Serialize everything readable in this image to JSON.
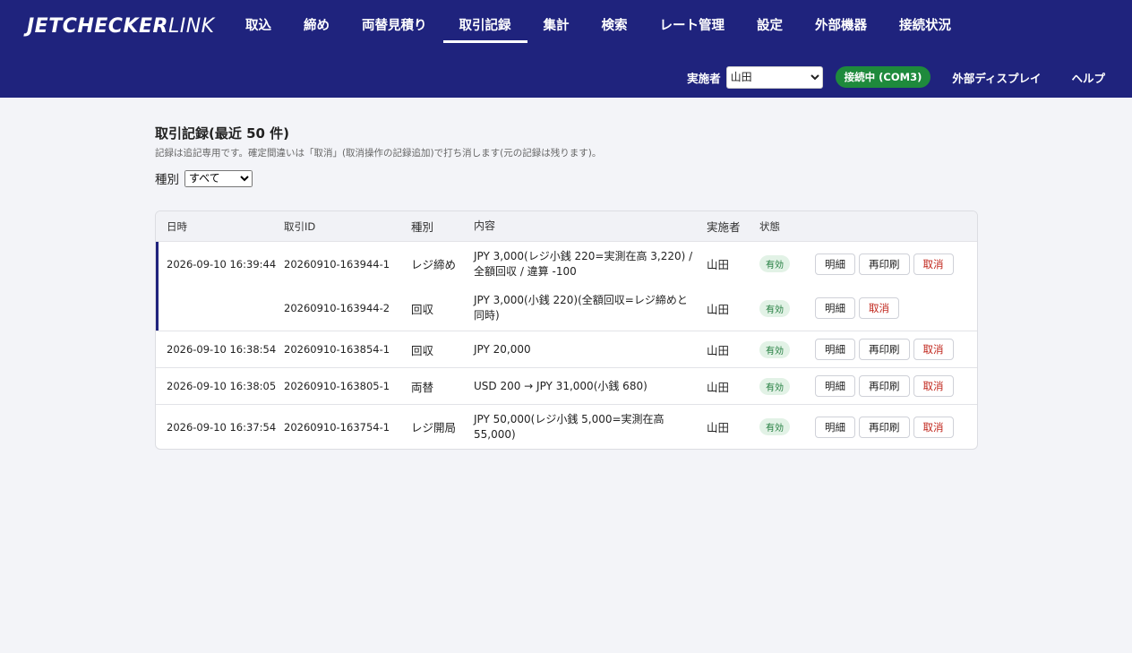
{
  "app": {
    "logo_bold": "JETCHECKER",
    "logo_light": "LINK"
  },
  "nav": [
    "取込",
    "締め",
    "両替見積り",
    "取引記録",
    "集計",
    "検索",
    "レート管理",
    "設定",
    "外部機器",
    "接続状況"
  ],
  "nav_active_index": 3,
  "subbar": {
    "operator_label": "実施者",
    "operator_value": "山田",
    "connection": "接続中 (COM3)",
    "external_display": "外部ディスプレイ",
    "help": "ヘルプ"
  },
  "page": {
    "title": "取引記録(最近 50 件)",
    "description": "記録は追記専用です。確定間違いは「取消」(取消操作の記録追加)で打ち消します(元の記録は残ります)。",
    "filter_label": "種別",
    "filter_value": "すべて"
  },
  "table": {
    "headers": {
      "date": "日時",
      "id": "取引ID",
      "type": "種別",
      "content": "内容",
      "operator": "実施者",
      "status": "状態"
    },
    "rows": [
      {
        "date": "2026-09-10 16:39:44",
        "id": "20260910-163944-1",
        "type": "レジ締め",
        "content": "JPY 3,000(レジ小銭 220=実測在高 3,220) / 全額回収 / 違算 -100",
        "operator": "山田",
        "status": "有効"
      },
      {
        "date": "",
        "id": "20260910-163944-2",
        "type": "回収",
        "content": "JPY 3,000(小銭 220)(全額回収=レジ締めと同時)",
        "operator": "山田",
        "status": "有効"
      },
      {
        "date": "2026-09-10 16:38:54",
        "id": "20260910-163854-1",
        "type": "回収",
        "content": "JPY 20,000",
        "operator": "山田",
        "status": "有効"
      },
      {
        "date": "2026-09-10 16:38:05",
        "id": "20260910-163805-1",
        "type": "両替",
        "content": "USD 200 → JPY 31,000(小銭 680)",
        "operator": "山田",
        "status": "有効"
      },
      {
        "date": "2026-09-10 16:37:54",
        "id": "20260910-163754-1",
        "type": "レジ開局",
        "content": "JPY 50,000(レジ小銭 5,000=実測在高 55,000)",
        "operator": "山田",
        "status": "有効"
      }
    ],
    "actions": {
      "detail": "明細",
      "reprint": "再印刷",
      "cancel": "取消"
    }
  }
}
